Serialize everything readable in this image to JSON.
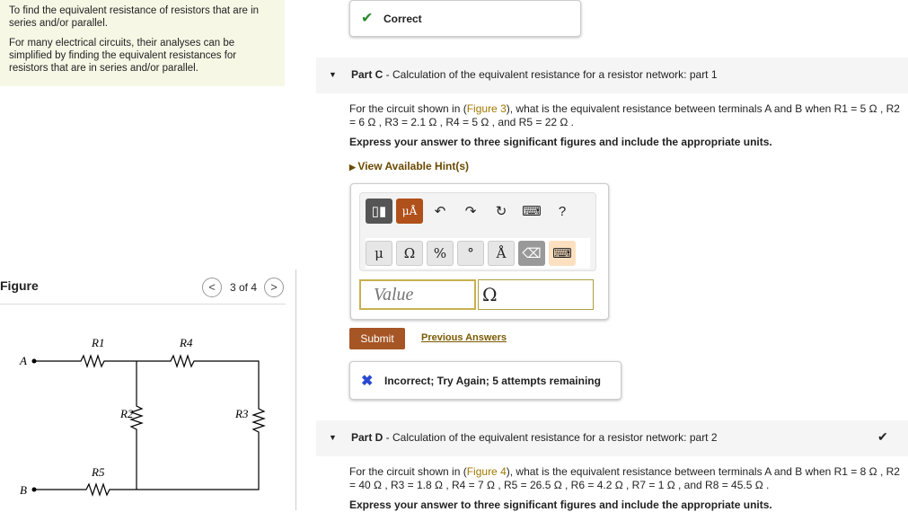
{
  "intro": {
    "p1": "To find the equivalent resistance of resistors that are in series and/or parallel.",
    "p2": "For many electrical circuits, their analyses can be simplified by finding the equivalent resistances for resistors that are in series and/or parallel."
  },
  "figure": {
    "label": "Figure",
    "pager": "3 of 4",
    "prev": "<",
    "next": ">",
    "labels": {
      "A": "A",
      "B": "B",
      "R1": "R1",
      "R2": "R2",
      "R3": "R3",
      "R4": "R4",
      "R5": "R5"
    }
  },
  "correct_banner": "Correct",
  "partC": {
    "part": "Part C",
    "title": " - Calculation of the equivalent resistance for a resistor network: part 1",
    "q_pre": "For the circuit shown in (",
    "q_link": "Figure 3",
    "q_post": "), what is the equivalent resistance between terminals A and B when R1 = 5 Ω , R2 = 6 Ω , R3 = 2.1 Ω , R4 = 5 Ω , and R5 = 22 Ω .",
    "instruction": "Express your answer to three significant figures and include the appropriate units.",
    "hints": "View Available Hint(s)",
    "toolbar": {
      "units": "μÅ",
      "help": "?"
    },
    "keys": [
      "μ",
      "Ω",
      "%",
      "°",
      "Å"
    ],
    "value_placeholder": "Value",
    "unit_value": "Ω",
    "submit": "Submit",
    "previous": "Previous Answers",
    "feedback": "Incorrect; Try Again; 5 attempts remaining"
  },
  "partD": {
    "part": "Part D",
    "title": " - Calculation of the equivalent resistance for a resistor network: part 2",
    "q_pre": "For the circuit shown in (",
    "q_link": "Figure 4",
    "q_post": "), what is the equivalent resistance between terminals A and B when R1 = 8 Ω , R2 = 40 Ω , R3 = 1.8 Ω , R4 = 7 Ω , R5 = 26.5 Ω , R6 = 4.2 Ω , R7 = 1 Ω , and R8 = 45.5 Ω .",
    "instruction": "Express your answer to three significant figures and include the appropriate units."
  }
}
